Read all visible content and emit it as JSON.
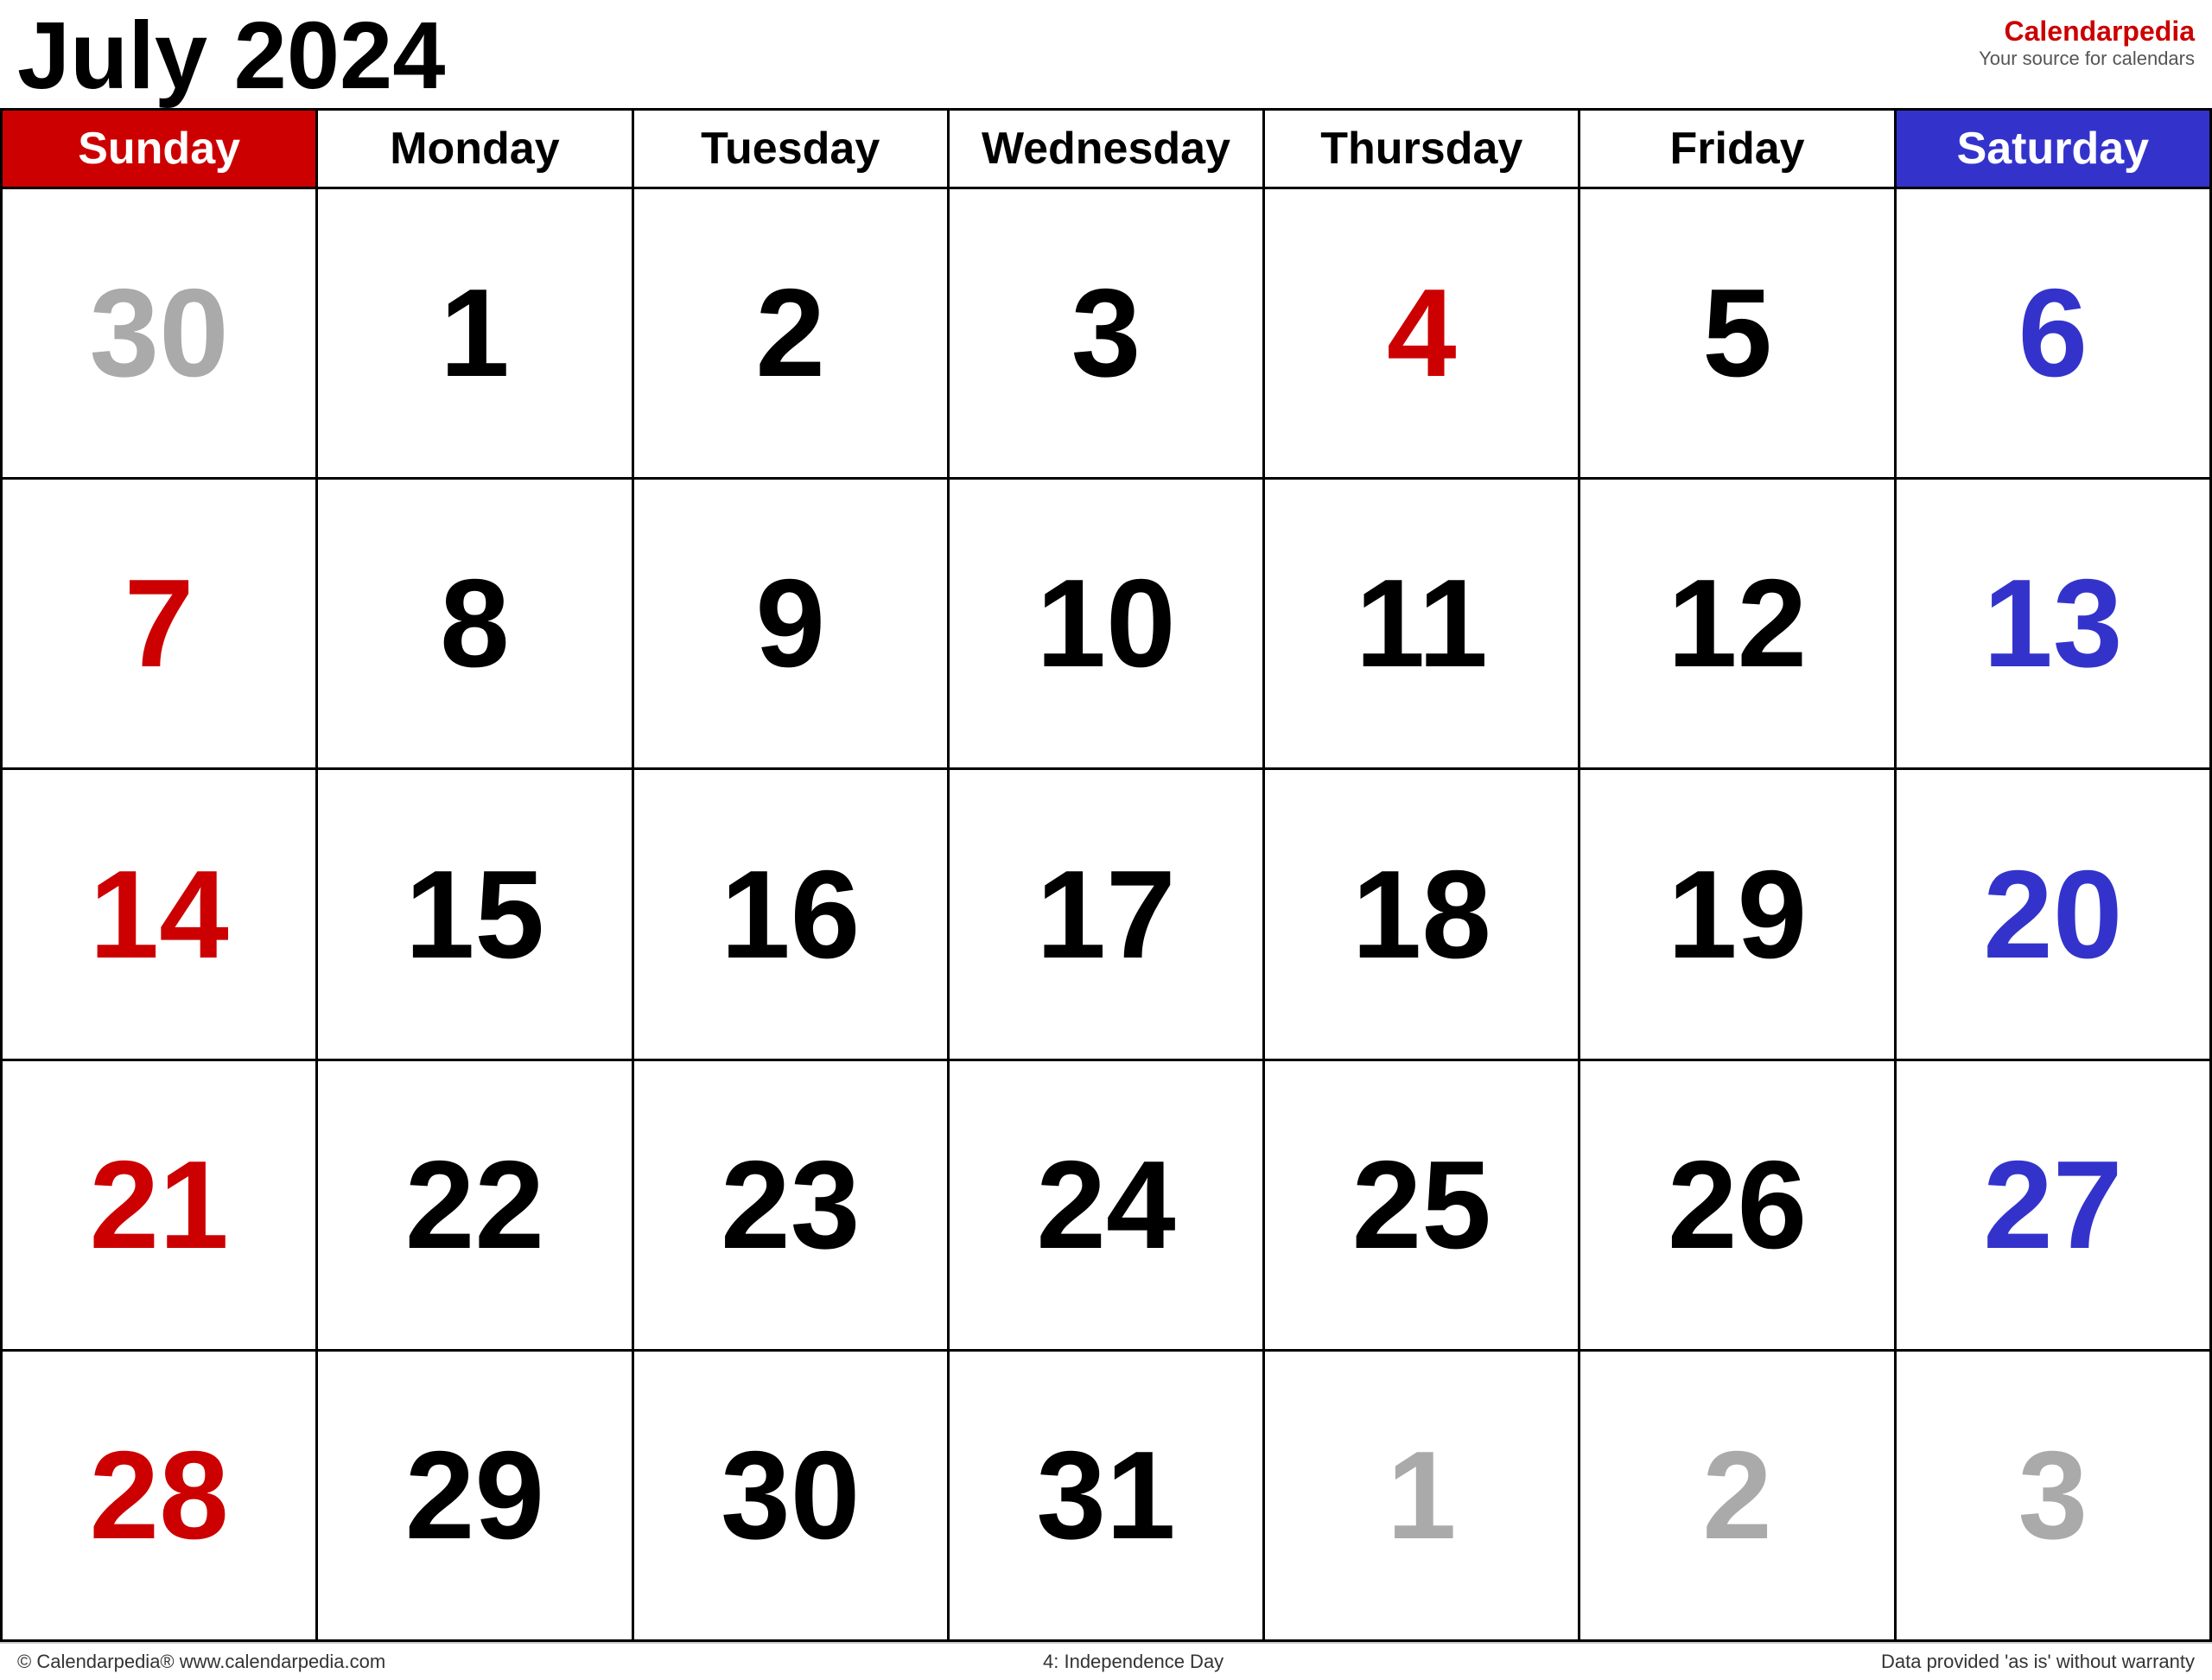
{
  "header": {
    "title": "July 2024",
    "brand_name": "Calendar",
    "brand_name_accent": "pedia",
    "brand_tagline": "Your source for calendars"
  },
  "day_headers": [
    {
      "label": "Sunday",
      "type": "sunday"
    },
    {
      "label": "Monday",
      "type": "weekday"
    },
    {
      "label": "Tuesday",
      "type": "weekday"
    },
    {
      "label": "Wednesday",
      "type": "weekday"
    },
    {
      "label": "Thursday",
      "type": "weekday"
    },
    {
      "label": "Friday",
      "type": "weekday"
    },
    {
      "label": "Saturday",
      "type": "saturday"
    }
  ],
  "weeks": [
    [
      {
        "day": "30",
        "color": "gray"
      },
      {
        "day": "1",
        "color": "black"
      },
      {
        "day": "2",
        "color": "black"
      },
      {
        "day": "3",
        "color": "black"
      },
      {
        "day": "4",
        "color": "red"
      },
      {
        "day": "5",
        "color": "black"
      },
      {
        "day": "6",
        "color": "blue"
      }
    ],
    [
      {
        "day": "7",
        "color": "red"
      },
      {
        "day": "8",
        "color": "black"
      },
      {
        "day": "9",
        "color": "black"
      },
      {
        "day": "10",
        "color": "black"
      },
      {
        "day": "11",
        "color": "black"
      },
      {
        "day": "12",
        "color": "black"
      },
      {
        "day": "13",
        "color": "blue"
      }
    ],
    [
      {
        "day": "14",
        "color": "red"
      },
      {
        "day": "15",
        "color": "black"
      },
      {
        "day": "16",
        "color": "black"
      },
      {
        "day": "17",
        "color": "black"
      },
      {
        "day": "18",
        "color": "black"
      },
      {
        "day": "19",
        "color": "black"
      },
      {
        "day": "20",
        "color": "blue"
      }
    ],
    [
      {
        "day": "21",
        "color": "red"
      },
      {
        "day": "22",
        "color": "black"
      },
      {
        "day": "23",
        "color": "black"
      },
      {
        "day": "24",
        "color": "black"
      },
      {
        "day": "25",
        "color": "black"
      },
      {
        "day": "26",
        "color": "black"
      },
      {
        "day": "27",
        "color": "blue"
      }
    ],
    [
      {
        "day": "28",
        "color": "red"
      },
      {
        "day": "29",
        "color": "black"
      },
      {
        "day": "30",
        "color": "black"
      },
      {
        "day": "31",
        "color": "black"
      },
      {
        "day": "1",
        "color": "gray"
      },
      {
        "day": "2",
        "color": "gray"
      },
      {
        "day": "3",
        "color": "gray"
      }
    ]
  ],
  "footer": {
    "left": "© Calendarpedia®   www.calendarpedia.com",
    "center": "4: Independence Day",
    "right": "Data provided 'as is' without warranty"
  }
}
